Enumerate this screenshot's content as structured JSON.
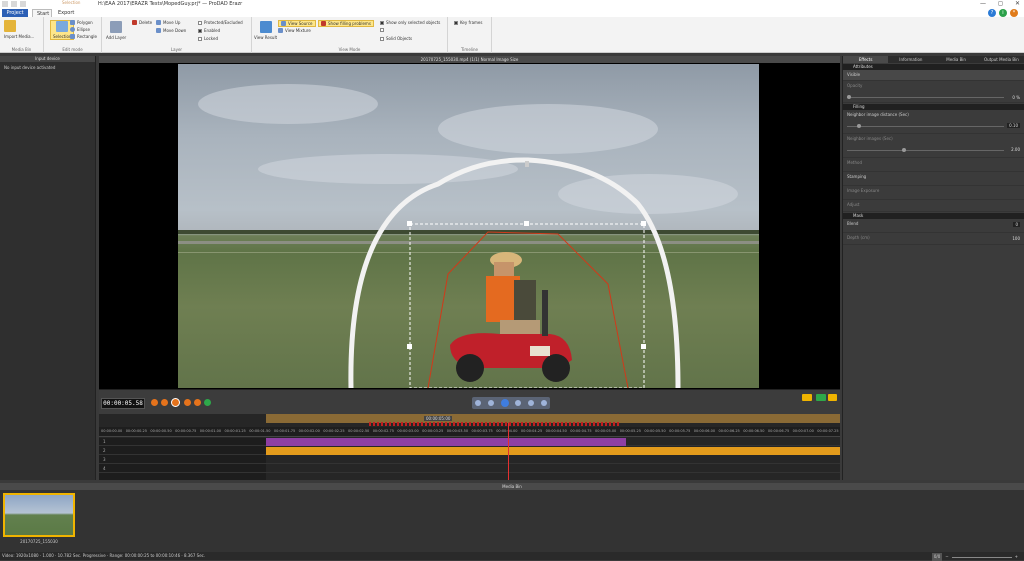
{
  "window": {
    "title": "H:\\EAA 2017\\ERAZR Tests\\MopedGuy.prj* — ProDAD Erazr",
    "subtab": "Selection",
    "minimize": "—",
    "maximize": "◻",
    "close": "✕"
  },
  "tabs": {
    "project": "Project",
    "start": "Start",
    "export": "Export Media"
  },
  "ribbon": {
    "media_bin": {
      "import": "Import Media...",
      "label": "Media Bin"
    },
    "edit_mode": {
      "selection": "Selection",
      "polygon": "Polygon",
      "ellipse": "Ellipse",
      "rectangle": "Rectangle",
      "label": "Edit mode"
    },
    "layer": {
      "add_layer": "Add Layer",
      "delete": "Delete",
      "move_up": "Move Up",
      "move_down": "Move Down",
      "protected": "Protected/Excluded",
      "enabled": "Enabled",
      "locked": "Locked",
      "label": "Layer"
    },
    "view_mode": {
      "view_result": "View Result",
      "view_source": "View Source",
      "view_mixture": "View Mixture",
      "show_filling": "Show filling problems",
      "show_only_selected": "Show only selected objects",
      "solid_objects": "Solid Objects",
      "label": "View Mode"
    },
    "timeline": {
      "key_frames": "Key frames",
      "label": "Timeline"
    }
  },
  "left_panel": {
    "title": "Input device",
    "message": "No input device activated"
  },
  "viewer": {
    "header": "20170725_155030.mp4   (1/1)   Normal Image Size"
  },
  "transport": {
    "timecode": "00:00:05.58"
  },
  "timeline": {
    "segment_label": "00:00:05:00",
    "ticks": [
      "00:00:00.00",
      "00:00:00.25",
      "00:00:00.50",
      "00:00:00.75",
      "00:00:01.00",
      "00:00:01.25",
      "00:00:01.50",
      "00:00:01.75",
      "00:00:02.00",
      "00:00:02.25",
      "00:00:02.50",
      "00:00:02.75",
      "00:00:03.00",
      "00:00:03.25",
      "00:00:03.50",
      "00:00:03.75",
      "00:00:04.00",
      "00:00:04.25",
      "00:00:04.50",
      "00:00:04.75",
      "00:00:05.00",
      "00:00:05.25",
      "00:00:05.50",
      "00:00:05.75",
      "00:00:06.00",
      "00:00:06.25",
      "00:00:06.50",
      "00:00:06.75",
      "00:00:07.00",
      "00:00:07.25"
    ],
    "tracks": [
      "1",
      "2",
      "3",
      "4"
    ]
  },
  "right_panel": {
    "tabs": [
      "Effects",
      "Information",
      "Media Bin",
      "Output Media Bin"
    ],
    "sections": {
      "attributes": "Attributes",
      "visible": "Visible",
      "opacity": "Opacity",
      "opacity_value": "0 %",
      "filling": "Filling",
      "neighbor_distance": "Neighbor image distance (Sec)",
      "neighbor_distance_value": "0.10",
      "neighbor_images": "Neighbor images (Sec)",
      "neighbor_images_value": "2.00",
      "method": "Method",
      "stamping": "Stamping",
      "image_exposure": "Image Exposure",
      "adjust": "Adjust",
      "mask": "Mask",
      "blend": "Blend",
      "blend_value": "0",
      "depth": "Depth (cm)",
      "depth_value": "100"
    }
  },
  "media_bin": {
    "title": "Media Bin",
    "clip_name": "20170725_155030"
  },
  "status": {
    "text": "Video: 1920x1080 · 1.000 · 10.782 Sec. Progressive · Range: 00:00:00:25 to 00:00:10:46 · 8.367 Sec.",
    "zoom": "0/0"
  },
  "colors": {
    "accent": "#2b5fb5",
    "clip_orange": "#e39b1c",
    "clip_purple": "#8e3fa3",
    "playhead": "#e53030"
  }
}
